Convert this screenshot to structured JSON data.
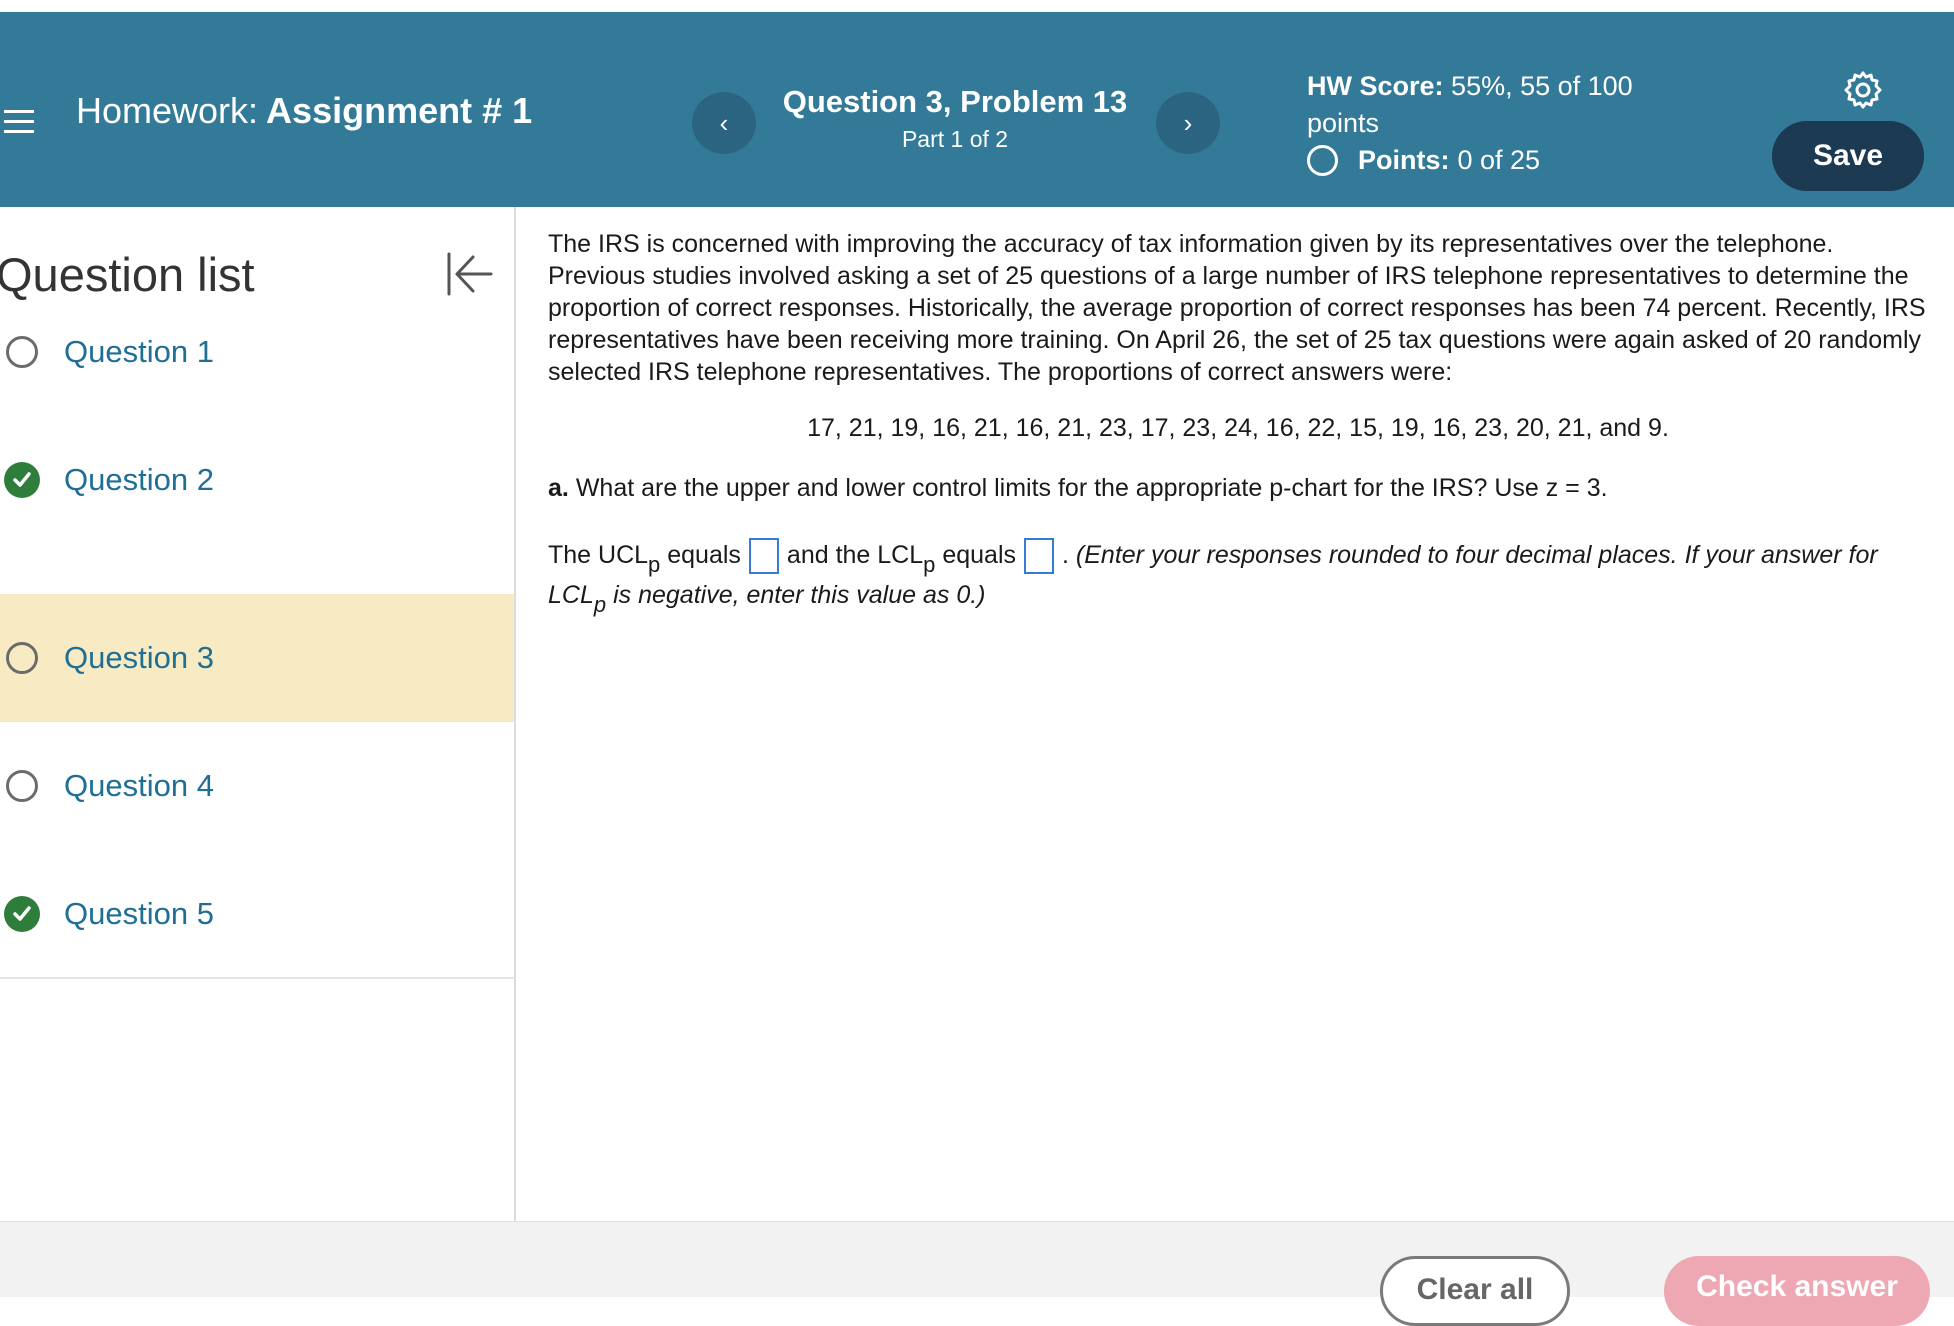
{
  "header": {
    "menu_icon": "hamburger-menu-icon",
    "homework_label": "Homework:",
    "assignment_name": "Assignment # 1",
    "question_title": "Question 3, Problem 13",
    "question_part": "Part 1 of 2",
    "prev_icon": "chevron-left-icon",
    "next_icon": "chevron-right-icon",
    "prev_glyph": "‹",
    "next_glyph": "›",
    "hw_score_label": "HW Score:",
    "hw_score_value": "55%, 55 of 100 points",
    "points_label": "Points:",
    "points_value": "0 of 25",
    "settings_icon": "gear-icon",
    "save_label": "Save",
    "bg_color": "#337a98"
  },
  "sidebar": {
    "title": "Question list",
    "collapse_icon": "collapse-left-icon",
    "items": [
      {
        "label": "Question 1",
        "status": "unanswered"
      },
      {
        "label": "Question 2",
        "status": "correct"
      },
      {
        "label": "Question 3",
        "status": "unanswered",
        "active": true
      },
      {
        "label": "Question 4",
        "status": "unanswered"
      },
      {
        "label": "Question 5",
        "status": "correct"
      }
    ]
  },
  "problem": {
    "paragraph": "The IRS is concerned with improving the accuracy of tax information given by its representatives over the telephone. Previous studies involved asking a set of 25 questions of a large number of IRS telephone representatives to determine the proportion of correct responses. Historically, the average proportion of correct responses has been 74 percent. Recently, IRS representatives have been receiving more training. On April 26, the set of 25 tax questions were again asked of 20 randomly selected IRS telephone representatives. The proportions of correct answers were:",
    "data_line": "17, 21, 19, 16, 21, 16, 21, 23, 17, 23, 24, 16, 22, 15, 19, 16, 23, 20, 21, and 9.",
    "part_a_label": "a.",
    "part_a_question": "What are the upper and lower control limits for the appropriate p-chart for the IRS? Use z = 3.",
    "answer": {
      "text1": "The UCL",
      "sub": "p",
      "text2": "equals",
      "text3": "and the LCL",
      "text4": "equals",
      "text5": ".",
      "instruction1": "(Enter your responses rounded to four decimal places. If your answer for LCL",
      "instruction2": "is negative, enter this value as 0.)",
      "ucl_value": "",
      "lcl_value": ""
    }
  },
  "footer": {
    "clear_label": "Clear all",
    "check_label": "Check answer"
  },
  "colors": {
    "accent_link": "#1f6f95",
    "active_row": "#f8ebc4",
    "correct_green": "#2e7d3a",
    "save_button": "#1c3a52",
    "check_button": "#eea8b4"
  }
}
